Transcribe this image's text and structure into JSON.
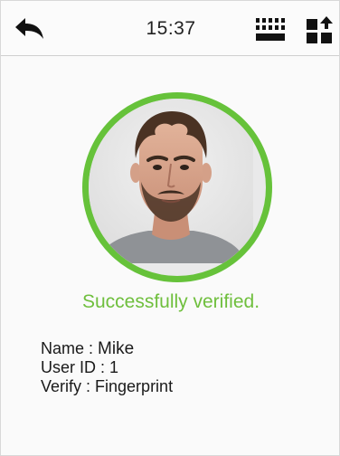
{
  "header": {
    "time": "15:37",
    "back_icon": "back-arrow-icon",
    "keyboard_icon": "keyboard-icon",
    "mode_icon": "verify-mode-icon"
  },
  "verification": {
    "status_text": "Successfully verified.",
    "status_color": "#6fbf3d",
    "ring_color": "#66c23a"
  },
  "user": {
    "name_label": "Name : ",
    "name": "Mike",
    "id_label": "User ID : ",
    "id": "1",
    "verify_label": "Verify : ",
    "verify_method": "Fingerprint"
  }
}
